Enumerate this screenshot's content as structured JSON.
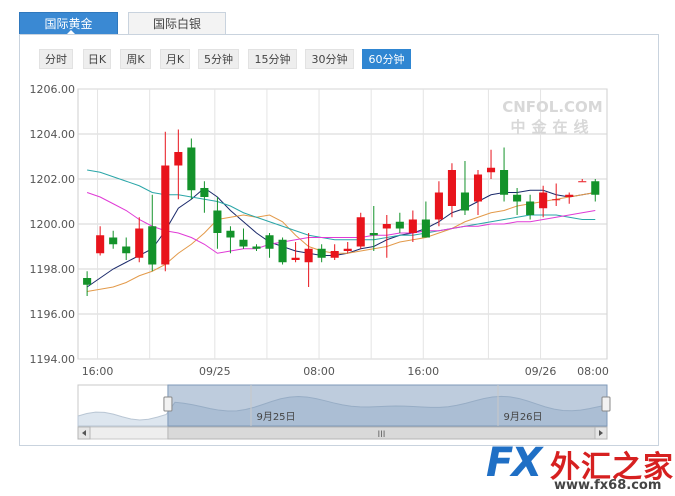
{
  "tabs": [
    {
      "label": "国际黄金",
      "active": true
    },
    {
      "label": "国际白银",
      "active": false
    }
  ],
  "periods": [
    {
      "label": "分时",
      "selected": false
    },
    {
      "label": "日K",
      "selected": false
    },
    {
      "label": "周K",
      "selected": false
    },
    {
      "label": "月K",
      "selected": false
    },
    {
      "label": "5分钟",
      "selected": false
    },
    {
      "label": "15分钟",
      "selected": false
    },
    {
      "label": "30分钟",
      "selected": false
    },
    {
      "label": "60分钟",
      "selected": true
    }
  ],
  "watermark": {
    "line1": "CNFOL.COM",
    "line2": "中金在线"
  },
  "colors": {
    "up": "#e8141c",
    "down": "#13922a",
    "ma1": "#1b2a6b",
    "ma2": "#e39a4a",
    "ma3": "#2aa6a8",
    "ma4": "#e03ad6",
    "accent": "#2f86d2"
  },
  "chart_data": {
    "type": "candlestick",
    "ylim": [
      1194,
      1206
    ],
    "y_ticks": [
      "1194.00",
      "1196.00",
      "1198.00",
      "1200.00",
      "1202.00",
      "1204.00",
      "1206.00"
    ],
    "x_ticks": [
      "16:00",
      "09/25",
      "08:00",
      "16:00",
      "09/26",
      "08:00"
    ],
    "candles": [
      {
        "o": 1197.6,
        "h": 1197.9,
        "l": 1196.8,
        "c": 1197.3
      },
      {
        "o": 1198.7,
        "h": 1199.9,
        "l": 1198.6,
        "c": 1199.5
      },
      {
        "o": 1199.4,
        "h": 1199.7,
        "l": 1198.9,
        "c": 1199.1
      },
      {
        "o": 1199.0,
        "h": 1199.4,
        "l": 1198.4,
        "c": 1198.7
      },
      {
        "o": 1198.5,
        "h": 1200.3,
        "l": 1198.3,
        "c": 1199.8
      },
      {
        "o": 1199.9,
        "h": 1201.3,
        "l": 1197.9,
        "c": 1198.2
      },
      {
        "o": 1198.2,
        "h": 1204.1,
        "l": 1197.9,
        "c": 1202.6
      },
      {
        "o": 1202.6,
        "h": 1204.2,
        "l": 1201.1,
        "c": 1203.2
      },
      {
        "o": 1203.4,
        "h": 1203.8,
        "l": 1201.1,
        "c": 1201.5
      },
      {
        "o": 1201.6,
        "h": 1201.9,
        "l": 1200.5,
        "c": 1201.2
      },
      {
        "o": 1200.6,
        "h": 1201.2,
        "l": 1198.9,
        "c": 1199.6
      },
      {
        "o": 1199.7,
        "h": 1199.9,
        "l": 1198.7,
        "c": 1199.4
      },
      {
        "o": 1199.3,
        "h": 1199.8,
        "l": 1198.9,
        "c": 1199.0
      },
      {
        "o": 1199.0,
        "h": 1199.1,
        "l": 1198.8,
        "c": 1198.9
      },
      {
        "o": 1199.5,
        "h": 1199.6,
        "l": 1198.5,
        "c": 1198.9
      },
      {
        "o": 1199.3,
        "h": 1199.4,
        "l": 1198.2,
        "c": 1198.3
      },
      {
        "o": 1198.4,
        "h": 1199.2,
        "l": 1198.3,
        "c": 1198.5
      },
      {
        "o": 1198.3,
        "h": 1199.6,
        "l": 1197.2,
        "c": 1198.9
      },
      {
        "o": 1198.9,
        "h": 1199.1,
        "l": 1198.3,
        "c": 1198.5
      },
      {
        "o": 1198.5,
        "h": 1199.1,
        "l": 1198.4,
        "c": 1198.8
      },
      {
        "o": 1198.8,
        "h": 1199.2,
        "l": 1198.7,
        "c": 1198.9
      },
      {
        "o": 1199.0,
        "h": 1200.5,
        "l": 1198.9,
        "c": 1200.3
      },
      {
        "o": 1199.6,
        "h": 1200.8,
        "l": 1198.8,
        "c": 1199.5
      },
      {
        "o": 1199.8,
        "h": 1200.4,
        "l": 1198.5,
        "c": 1200.0
      },
      {
        "o": 1200.1,
        "h": 1200.5,
        "l": 1199.6,
        "c": 1199.8
      },
      {
        "o": 1199.6,
        "h": 1200.6,
        "l": 1199.2,
        "c": 1200.2
      },
      {
        "o": 1200.2,
        "h": 1201.0,
        "l": 1199.4,
        "c": 1199.4
      },
      {
        "o": 1200.2,
        "h": 1201.9,
        "l": 1199.9,
        "c": 1201.4
      },
      {
        "o": 1200.8,
        "h": 1202.7,
        "l": 1200.3,
        "c": 1202.4
      },
      {
        "o": 1201.4,
        "h": 1202.8,
        "l": 1200.4,
        "c": 1200.6
      },
      {
        "o": 1201.0,
        "h": 1202.4,
        "l": 1200.4,
        "c": 1202.2
      },
      {
        "o": 1202.3,
        "h": 1203.3,
        "l": 1202.0,
        "c": 1202.5
      },
      {
        "o": 1202.4,
        "h": 1203.4,
        "l": 1201.0,
        "c": 1201.3
      },
      {
        "o": 1201.3,
        "h": 1201.6,
        "l": 1200.4,
        "c": 1201.0
      },
      {
        "o": 1201.0,
        "h": 1201.3,
        "l": 1200.2,
        "c": 1200.4
      },
      {
        "o": 1200.7,
        "h": 1201.7,
        "l": 1200.3,
        "c": 1201.4
      },
      {
        "o": 1201.1,
        "h": 1201.8,
        "l": 1200.8,
        "c": 1201.1
      },
      {
        "o": 1201.2,
        "h": 1201.4,
        "l": 1200.9,
        "c": 1201.3
      },
      {
        "o": 1201.9,
        "h": 1202.0,
        "l": 1201.9,
        "c": 1201.9
      },
      {
        "o": 1201.9,
        "h": 1202.0,
        "l": 1201.0,
        "c": 1201.3
      }
    ],
    "ma_lines": [
      {
        "color": "#1b2a6b",
        "values": [
          1197.2,
          1197.6,
          1198.0,
          1198.3,
          1198.6,
          1198.9,
          1199.7,
          1200.7,
          1201.1,
          1201.6,
          1201.2,
          1200.6,
          1200.1,
          1199.6,
          1199.2,
          1199.0,
          1198.8,
          1198.7,
          1198.6,
          1198.6,
          1198.7,
          1198.9,
          1199.0,
          1199.3,
          1199.5,
          1199.6,
          1199.8,
          1200.1,
          1200.5,
          1200.7,
          1201.0,
          1201.3,
          1201.4,
          1201.4,
          1201.5,
          1201.5,
          1201.3,
          1201.2,
          1201.3,
          1201.4
        ]
      },
      {
        "color": "#e39a4a",
        "values": [
          1197.0,
          1197.1,
          1197.2,
          1197.4,
          1197.7,
          1197.9,
          1198.2,
          1198.7,
          1199.1,
          1199.6,
          1200.2,
          1200.3,
          1200.4,
          1200.3,
          1200.4,
          1200.1,
          1199.5,
          1199.0,
          1198.8,
          1198.7,
          1198.7,
          1198.8,
          1198.9,
          1199.0,
          1199.2,
          1199.3,
          1199.4,
          1199.6,
          1199.8,
          1200.1,
          1200.3,
          1200.5,
          1200.6,
          1200.8,
          1200.9,
          1201.0,
          1201.1,
          1201.2,
          1201.3,
          1201.4
        ]
      },
      {
        "color": "#2aa6a8",
        "values": [
          1202.4,
          1202.3,
          1202.1,
          1201.9,
          1201.7,
          1201.4,
          1201.3,
          1201.3,
          1201.2,
          1201.1,
          1201.0,
          1200.8,
          1200.5,
          1200.3,
          1200.1,
          1199.9,
          1199.7,
          1199.5,
          1199.4,
          1199.3,
          1199.3,
          1199.3,
          1199.3,
          1199.4,
          1199.5,
          1199.5,
          1199.6,
          1199.7,
          1199.8,
          1199.9,
          1200.0,
          1200.1,
          1200.2,
          1200.3,
          1200.4,
          1200.4,
          1200.4,
          1200.3,
          1200.2,
          1200.2
        ]
      },
      {
        "color": "#e03ad6",
        "values": [
          1201.4,
          1201.2,
          1200.9,
          1200.6,
          1200.2,
          1199.9,
          1199.7,
          1199.6,
          1199.4,
          1199.1,
          1198.7,
          1198.8,
          1198.9,
          1198.9,
          1199.1,
          1199.2,
          1199.3,
          1199.4,
          1199.4,
          1199.4,
          1199.4,
          1199.4,
          1199.5,
          1199.5,
          1199.6,
          1199.6,
          1199.7,
          1199.7,
          1199.8,
          1199.9,
          1199.9,
          1200.0,
          1200.0,
          1200.1,
          1200.1,
          1200.2,
          1200.3,
          1200.4,
          1200.5,
          1200.6
        ]
      }
    ],
    "navigator": {
      "labels": [
        "9月25日",
        "9月26日"
      ],
      "selection": [
        0.17,
        1.0
      ]
    }
  },
  "logo": {
    "fx": "FX",
    "cn": "外汇之家",
    "url": "www.fx68.com"
  }
}
